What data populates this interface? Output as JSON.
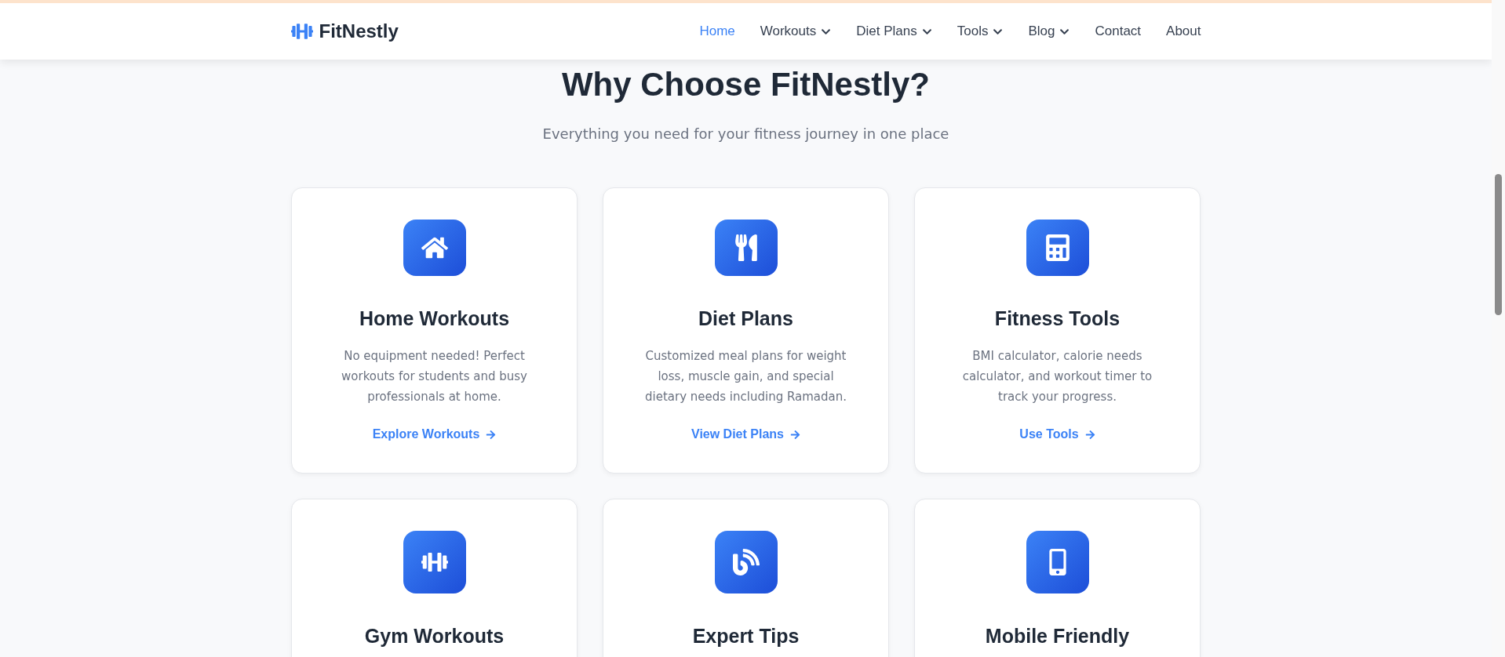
{
  "header": {
    "logo": "FitNestly",
    "nav": [
      {
        "label": "Home",
        "kind": "link",
        "selected": true
      },
      {
        "label": "Workouts",
        "kind": "dropdown",
        "selected": false
      },
      {
        "label": "Diet Plans",
        "kind": "dropdown",
        "selected": false
      },
      {
        "label": "Tools",
        "kind": "dropdown",
        "selected": false
      },
      {
        "label": "Blog",
        "kind": "dropdown",
        "selected": false
      },
      {
        "label": "Contact",
        "kind": "link",
        "selected": false
      },
      {
        "label": "About",
        "kind": "link",
        "selected": false
      }
    ]
  },
  "section": {
    "title": "Why Choose FitNestly?",
    "subtitle": "Everything you need for your fitness journey in one place"
  },
  "features": [
    {
      "title": "Home Workouts",
      "description": "No equipment needed! Perfect workouts for students and busy professionals at home.",
      "link": "Explore Workouts"
    },
    {
      "title": "Diet Plans",
      "description": "Customized meal plans for weight loss, muscle gain, and special dietary needs including Ramadan.",
      "link": "View Diet Plans"
    },
    {
      "title": "Fitness Tools",
      "description": "BMI calculator, calorie needs calculator, and workout timer to track your progress.",
      "link": "Use Tools"
    },
    {
      "title": "Gym Workouts"
    },
    {
      "title": "Expert Tips"
    },
    {
      "title": "Mobile Friendly"
    }
  ]
}
